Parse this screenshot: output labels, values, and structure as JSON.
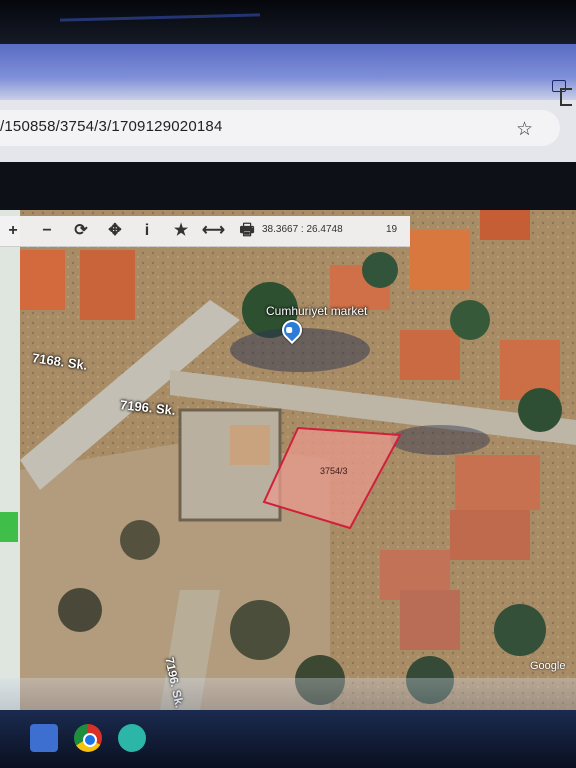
{
  "browser": {
    "url": "/150858/3754/3/1709129020184",
    "bookmark_icon": "star-icon"
  },
  "toolbar": {
    "buttons": [
      {
        "name": "zoom-in-button",
        "glyph": "+"
      },
      {
        "name": "zoom-out-button",
        "glyph": "−"
      },
      {
        "name": "refresh-button",
        "glyph": "⟳"
      },
      {
        "name": "pan-button",
        "glyph": "✥"
      },
      {
        "name": "info-button",
        "glyph": "i"
      },
      {
        "name": "favorite-button",
        "glyph": "★"
      },
      {
        "name": "measure-button",
        "glyph": "⟷"
      },
      {
        "name": "print-button",
        "glyph": "🖶"
      }
    ],
    "coordinates": "38.3667 : 26.4748",
    "zoom_level": "19"
  },
  "map": {
    "streets": [
      "7168. Sk.",
      "7196. Sk.",
      "7196. Sk."
    ],
    "poi": "Cumhuriyet market",
    "parcel_label": "3754/3",
    "attribution": "Google",
    "colors": {
      "parcel_fill": "#e89a8c",
      "parcel_stroke": "#d0203a",
      "road": "#c9c2b3",
      "roof": "#d9693a"
    }
  }
}
